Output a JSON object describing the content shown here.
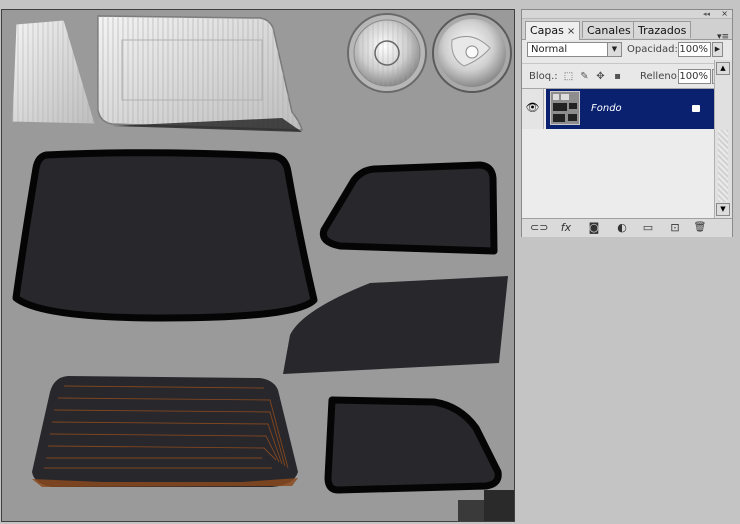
{
  "panel": {
    "tabs": [
      {
        "label": "Capas",
        "close": "×"
      },
      {
        "label": "Canales"
      },
      {
        "label": "Trazados"
      }
    ],
    "collapse_glyph": "◂◂",
    "close_glyph": "×",
    "menu_glyph": "▾≡",
    "blend_mode": "Normal",
    "opacity_label": "Opacidad:",
    "opacity_value": "100%",
    "lock_label": "Bloq.:",
    "fill_label": "Relleno:",
    "fill_value": "100%",
    "layers": [
      {
        "name": "Fondo",
        "visible": true,
        "locked": true
      }
    ],
    "bottom_icons": [
      "link-icon",
      "fx-icon",
      "mask-icon",
      "adjustment-icon",
      "folder-icon",
      "new-layer-icon",
      "trash-icon"
    ],
    "bottom_labels": {
      "link": "⊂⊃",
      "fx": "fx",
      "mask": "◙",
      "adjust": "◐",
      "folder": "▭",
      "new": "⊡",
      "trash": "🗑"
    }
  },
  "colors": {
    "canvas_bg": "#9a9a9a",
    "glass": "#28272c",
    "frame": "#050505",
    "selection": "#0a2170",
    "defroster": "#8a4a1e"
  }
}
